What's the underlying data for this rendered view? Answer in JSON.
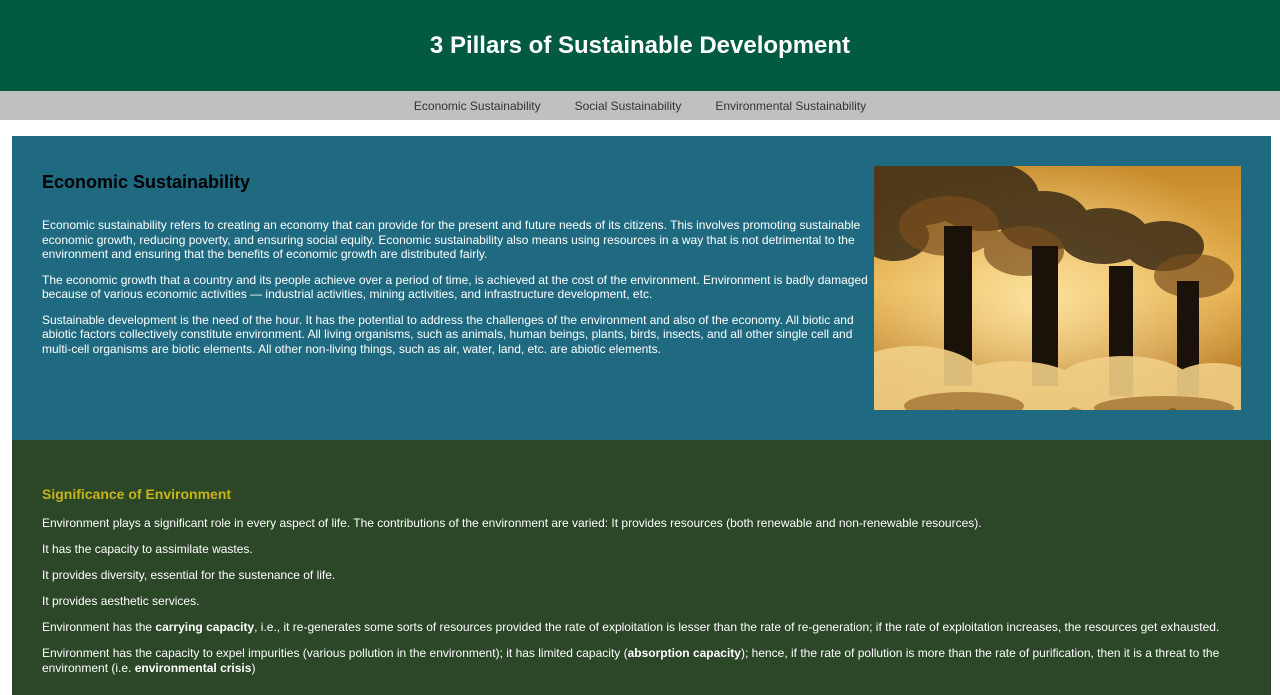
{
  "header": {
    "title": "3 Pillars of Sustainable Development"
  },
  "nav": {
    "items": [
      {
        "label": "Economic Sustainability"
      },
      {
        "label": "Social Sustainability"
      },
      {
        "label": "Environmental Sustainability"
      }
    ]
  },
  "economic": {
    "title": "Economic Sustainability",
    "paragraphs": [
      "Economic sustainability refers to creating an economy that can provide for the present and future needs of its citizens. This involves promoting sustainable economic growth, reducing poverty, and ensuring social equity. Economic sustainability also means using resources in a way that is not detrimental to the environment and ensuring that the benefits of economic growth are distributed fairly.",
      "The economic growth that a country and its people achieve over a period of time, is achieved at the cost of the environment. Environment is badly damaged because of various economic activities — industrial activities, mining activities, and infrastructure development, etc.",
      "Sustainable development is the need of the hour. It has the potential to address the challenges of the environment and also of the economy. All biotic and abiotic factors collectively constitute environment. All living organisms, such as animals, human beings, plants, birds, insects, and all other single cell and multi-cell organisms are biotic elements. All other non-living things, such as air, water, land, etc. are abiotic elements."
    ]
  },
  "environment": {
    "title": "Significance of Environment",
    "p1": "Environment plays a significant role in every aspect of life. The contributions of the environment are varied: It provides resources (both renewable and non-renewable resources).",
    "p2": "It has the capacity to assimilate wastes.",
    "p3": "It provides diversity, essential for the sustenance of life.",
    "p4": "It provides aesthetic services.",
    "p5": {
      "before": "Environment has the ",
      "bold": "carrying capacity",
      "after": ", i.e., it re-generates some sorts of resources provided the rate of exploitation is lesser than the rate of re-generation; if the rate of exploitation increases, the resources get exhausted."
    },
    "p6": {
      "before": "Environment has the capacity to expel impurities (various pollution in the environment); it has limited capacity (",
      "bold1": "absorption capacity",
      "middle": "); hence, if the rate of pollution is more than the rate of purification, then it is a threat to the environment (i.e. ",
      "bold2": "environmental crisis",
      "after": ")"
    }
  },
  "colors": {
    "header_bg": "#025a40",
    "nav_bg": "#c0c0c0",
    "economic_bg": "#1f6a80",
    "environment_bg": "#2c4628",
    "accent_title": "#c6b41b"
  }
}
